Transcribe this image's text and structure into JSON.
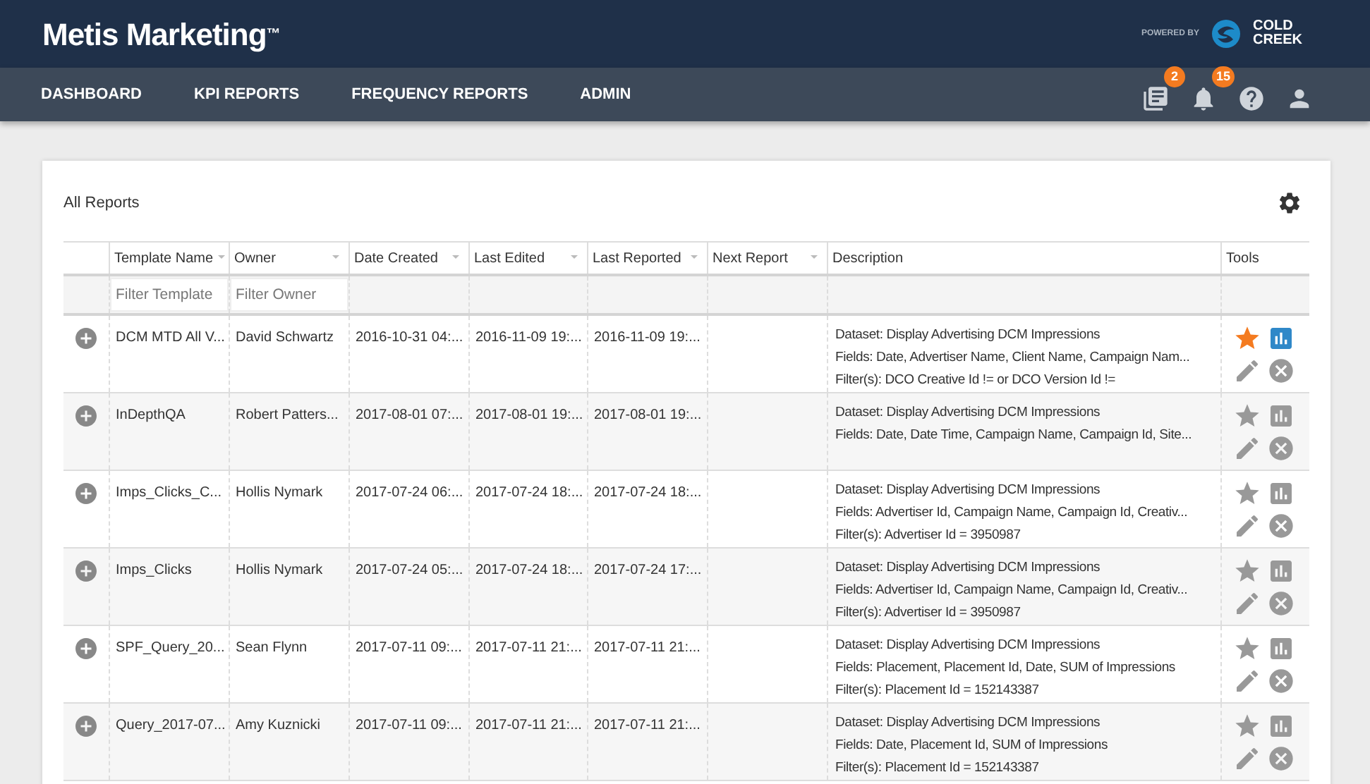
{
  "brand": {
    "title": "Metis Marketing",
    "trademark": "™",
    "powered_by": "POWERED BY",
    "partner_line_1": "COLD",
    "partner_line_2": "CREEK"
  },
  "nav": {
    "items": [
      {
        "label": "DASHBOARD"
      },
      {
        "label": "KPI REPORTS"
      },
      {
        "label": "FREQUENCY REPORTS"
      },
      {
        "label": "ADMIN"
      }
    ],
    "icons": [
      {
        "kind": "reports",
        "badge": "2"
      },
      {
        "kind": "bell",
        "badge": "15"
      },
      {
        "kind": "help"
      },
      {
        "kind": "user"
      }
    ]
  },
  "panel": {
    "title": "All Reports"
  },
  "table": {
    "columns": [
      {
        "label": "Template Name",
        "sortable": true,
        "filter_placeholder": "Filter Template"
      },
      {
        "label": "Owner",
        "sortable": true,
        "filter_placeholder": "Filter Owner"
      },
      {
        "label": "Date Created",
        "sortable": true
      },
      {
        "label": "Last Edited",
        "sortable": true
      },
      {
        "label": "Last Reported",
        "sortable": true
      },
      {
        "label": "Next Report",
        "sortable": true
      },
      {
        "label": "Description",
        "sortable": false
      },
      {
        "label": "Tools",
        "sortable": false
      }
    ],
    "rows": [
      {
        "template": "DCM MTD All V...",
        "owner": "David Schwartz",
        "created": "2016-10-31 04:...",
        "edited": "2016-11-09 19:...",
        "reported": "2016-11-09 19:...",
        "description": [
          "Dataset: Display Advertising DCM Impressions",
          "Fields: Date, Advertiser Name, Client Name, Campaign Nam...",
          "Filter(s): DCO Creative Id != or DCO Version Id !="
        ],
        "starred": true,
        "chart_active": true
      },
      {
        "template": "InDepthQA",
        "owner": "Robert Patters...",
        "created": "2017-08-01 07:...",
        "edited": "2017-08-01 19:...",
        "reported": "2017-08-01 19:...",
        "description": [
          "Dataset: Display Advertising DCM Impressions",
          "Fields: Date, Date Time, Campaign Name, Campaign Id, Site..."
        ],
        "starred": false,
        "chart_active": false
      },
      {
        "template": "Imps_Clicks_C...",
        "owner": "Hollis Nymark",
        "created": "2017-07-24 06:...",
        "edited": "2017-07-24 18:...",
        "reported": "2017-07-24 18:...",
        "description": [
          "Dataset: Display Advertising DCM Impressions",
          "Fields: Advertiser Id, Campaign Name, Campaign Id, Creativ...",
          "Filter(s): Advertiser Id = 3950987"
        ],
        "starred": false,
        "chart_active": false
      },
      {
        "template": "Imps_Clicks",
        "owner": "Hollis Nymark",
        "created": "2017-07-24 05:...",
        "edited": "2017-07-24 18:...",
        "reported": "2017-07-24 17:...",
        "description": [
          "Dataset: Display Advertising DCM Impressions",
          "Fields: Advertiser Id, Campaign Name, Campaign Id, Creativ...",
          "Filter(s): Advertiser Id = 3950987"
        ],
        "starred": false,
        "chart_active": false
      },
      {
        "template": "SPF_Query_20...",
        "owner": "Sean Flynn",
        "created": "2017-07-11 09:...",
        "edited": "2017-07-11 21:...",
        "reported": "2017-07-11 21:...",
        "description": [
          "Dataset: Display Advertising DCM Impressions",
          "Fields: Placement, Placement Id, Date, SUM of Impressions",
          "Filter(s): Placement Id = 152143387"
        ],
        "starred": false,
        "chart_active": false
      },
      {
        "template": "Query_2017-07...",
        "owner": "Amy Kuznicki",
        "created": "2017-07-11 09:...",
        "edited": "2017-07-11 21:...",
        "reported": "2017-07-11 21:...",
        "description": [
          "Dataset: Display Advertising DCM Impressions",
          "Fields: Date, Placement Id, SUM of Impressions",
          "Filter(s): Placement Id = 152143387"
        ],
        "starred": false,
        "chart_active": false
      }
    ]
  }
}
